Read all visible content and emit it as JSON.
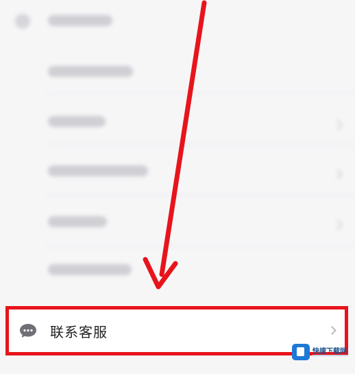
{
  "contact": {
    "label": "联系客服",
    "icon": "chat-bubble-icon"
  },
  "watermark": {
    "text": "快搜下载网"
  },
  "colors": {
    "highlight": "#e8141c",
    "arrow": "#e8141c",
    "background": "#f6f6f7"
  }
}
